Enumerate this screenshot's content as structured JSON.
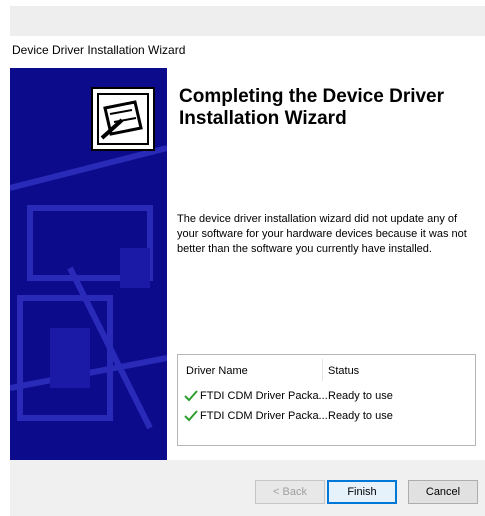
{
  "window": {
    "title": "Device Driver Installation Wizard"
  },
  "wizard": {
    "heading": "Completing the Device Driver Installation Wizard",
    "description": "The device driver installation wizard did not update any of your software for your hardware devices because it was not better than the software you currently have installed."
  },
  "table": {
    "headers": {
      "name": "Driver Name",
      "status": "Status"
    },
    "rows": [
      {
        "icon": "checkmark-icon",
        "name": "FTDI CDM Driver Packa...",
        "status": "Ready to use"
      },
      {
        "icon": "checkmark-icon",
        "name": "FTDI CDM Driver Packa...",
        "status": "Ready to use"
      }
    ]
  },
  "buttons": {
    "back": "< Back",
    "finish": "Finish",
    "cancel": "Cancel"
  },
  "colors": {
    "side_panel": "#0b0b8c",
    "check": "#2e9e2e",
    "default_button_border": "#0078d7"
  }
}
